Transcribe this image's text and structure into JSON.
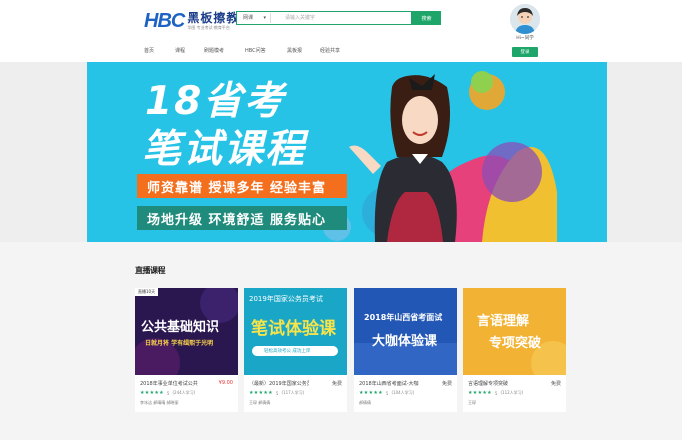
{
  "brand": {
    "logo_mark": "HBC",
    "name": "黑板擦教育",
    "tagline": "华图 专业考试·教育平台"
  },
  "search": {
    "scope": "网课",
    "placeholder": "请输入关键字",
    "button_label": "搜索"
  },
  "nav": {
    "items": [
      "首页",
      "课程",
      "刷题模考",
      "HBC问答",
      "黑板报",
      "经验共享"
    ]
  },
  "user": {
    "name": "Hi~同学",
    "login_label": "登录"
  },
  "banner": {
    "line1": "18省考",
    "line2": "笔试课程",
    "tag1": "师资靠谱 授课多年 经验丰富",
    "tag2": "场地升级 环境舒适 服务贴心",
    "colors": {
      "background": "#27c3e6",
      "tag1": "#f36f1e",
      "tag2": "#1f8b7c"
    }
  },
  "section": {
    "title": "直播课程"
  },
  "courses": [
    {
      "badge": "直播10天",
      "thumb_line1": "公共基础知识",
      "thumb_line2": "日就月将 学有缉熙于光明",
      "title": "2018年事业单位考试公共",
      "price": "¥9.00",
      "stars": "★★★★★",
      "rating": "5",
      "students": "(244人学习)",
      "teacher": "李冰洁 郝晴晴 郝晓丽"
    },
    {
      "thumb_line1": "2019年国家公务员考试",
      "thumb_line2": "笔试体验课",
      "thumb_line3": "轻松高效考公 成功上岸",
      "title": "（最新）2019年国家公务员",
      "price": "免费",
      "stars": "★★★★★",
      "rating": "5",
      "students": "(117人学习)",
      "teacher": "王琛 郝倩倩"
    },
    {
      "thumb_line1": "2018年山西省考面试",
      "thumb_line2": "大咖体验课",
      "title": "2018年山西省考面试-大咖",
      "price": "免费",
      "stars": "★★★★★",
      "rating": "5",
      "students": "(104人学习)",
      "teacher": "郝倩倩"
    },
    {
      "thumb_line1": "言语理解",
      "thumb_line2": "专项突破",
      "title": "言语理解专项突破",
      "price": "免费",
      "stars": "★★★★★",
      "rating": "5",
      "students": "(112人学习)",
      "teacher": "王琛"
    }
  ]
}
